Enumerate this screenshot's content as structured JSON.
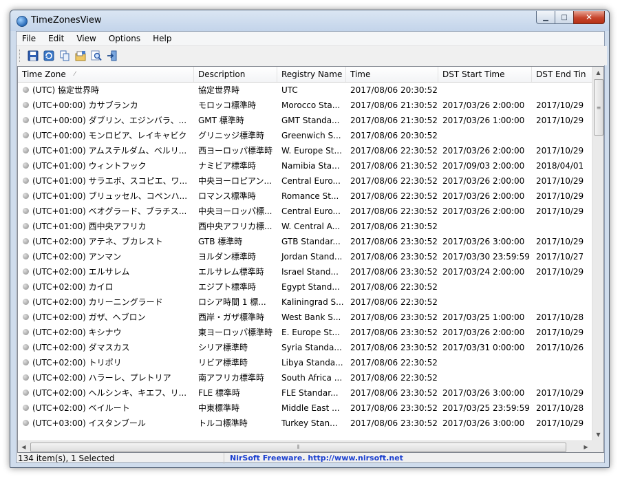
{
  "window": {
    "title": "TimeZonesView"
  },
  "menu": [
    "File",
    "Edit",
    "View",
    "Options",
    "Help"
  ],
  "toolbar": [
    {
      "name": "save-icon",
      "title": "Save Selected Items"
    },
    {
      "name": "refresh-icon",
      "title": "Refresh"
    },
    {
      "name": "copy-icon",
      "title": "Copy Selected Items"
    },
    {
      "name": "properties-icon",
      "title": "Properties"
    },
    {
      "name": "find-icon",
      "title": "Find"
    },
    {
      "name": "exit-icon",
      "title": "Exit"
    }
  ],
  "columns": [
    "Time Zone",
    "Description",
    "Registry Name",
    "Time",
    "DST Start Time",
    "DST End Tin"
  ],
  "sort_indicator": "⁄",
  "rows": [
    [
      "(UTC) 協定世界時",
      "協定世界時",
      "UTC",
      "2017/08/06 20:30:52",
      "",
      ""
    ],
    [
      "(UTC+00:00) カサブランカ",
      "モロッコ標準時",
      "Morocco Sta...",
      "2017/08/06 21:30:52",
      "2017/03/26 2:00:00",
      "2017/10/29"
    ],
    [
      "(UTC+00:00) ダブリン、エジンバラ、...",
      "GMT 標準時",
      "GMT Standa...",
      "2017/08/06 21:30:52",
      "2017/03/26 1:00:00",
      "2017/10/29"
    ],
    [
      "(UTC+00:00) モンロビア、レイキャビク",
      "グリニッジ標準時",
      "Greenwich S...",
      "2017/08/06 20:30:52",
      "",
      ""
    ],
    [
      "(UTC+01:00) アムステルダム、ベルリ...",
      "西ヨーロッパ標準時",
      "W. Europe St...",
      "2017/08/06 22:30:52",
      "2017/03/26 2:00:00",
      "2017/10/29"
    ],
    [
      "(UTC+01:00) ウィントフック",
      "ナミビア標準時",
      "Namibia Sta...",
      "2017/08/06 21:30:52",
      "2017/09/03 2:00:00",
      "2018/04/01"
    ],
    [
      "(UTC+01:00) サラエボ、スコピエ、ワ...",
      "中央ヨーロピアン...",
      "Central Euro...",
      "2017/08/06 22:30:52",
      "2017/03/26 2:00:00",
      "2017/10/29"
    ],
    [
      "(UTC+01:00) ブリュッセル、コペンハ...",
      "ロマンス標準時",
      "Romance St...",
      "2017/08/06 22:30:52",
      "2017/03/26 2:00:00",
      "2017/10/29"
    ],
    [
      "(UTC+01:00) ベオグラード、ブラチス...",
      "中央ヨーロッパ標...",
      "Central Euro...",
      "2017/08/06 22:30:52",
      "2017/03/26 2:00:00",
      "2017/10/29"
    ],
    [
      "(UTC+01:00) 西中央アフリカ",
      "西中央アフリカ標...",
      "W. Central A...",
      "2017/08/06 21:30:52",
      "",
      ""
    ],
    [
      "(UTC+02:00) アテネ、ブカレスト",
      "GTB 標準時",
      "GTB Standar...",
      "2017/08/06 23:30:52",
      "2017/03/26 3:00:00",
      "2017/10/29"
    ],
    [
      "(UTC+02:00) アンマン",
      "ヨルダン標準時",
      "Jordan Stand...",
      "2017/08/06 23:30:52",
      "2017/03/30 23:59:59",
      "2017/10/27"
    ],
    [
      "(UTC+02:00) エルサレム",
      "エルサレム標準時",
      "Israel Stand...",
      "2017/08/06 23:30:52",
      "2017/03/24 2:00:00",
      "2017/10/29"
    ],
    [
      "(UTC+02:00) カイロ",
      "エジプト標準時",
      "Egypt Stand...",
      "2017/08/06 22:30:52",
      "",
      ""
    ],
    [
      "(UTC+02:00) カリーニングラード",
      "ロシア時間 1 標...",
      "Kaliningrad S...",
      "2017/08/06 22:30:52",
      "",
      ""
    ],
    [
      "(UTC+02:00) ガザ、ヘブロン",
      "西岸・ガザ標準時",
      "West Bank S...",
      "2017/08/06 23:30:52",
      "2017/03/25 1:00:00",
      "2017/10/28"
    ],
    [
      "(UTC+02:00) キシナウ",
      "東ヨーロッパ標準時",
      "E. Europe St...",
      "2017/08/06 23:30:52",
      "2017/03/26 2:00:00",
      "2017/10/29"
    ],
    [
      "(UTC+02:00) ダマスカス",
      "シリア標準時",
      "Syria Standa...",
      "2017/08/06 23:30:52",
      "2017/03/31 0:00:00",
      "2017/10/26"
    ],
    [
      "(UTC+02:00) トリポリ",
      "リビア標準時",
      "Libya Standa...",
      "2017/08/06 22:30:52",
      "",
      ""
    ],
    [
      "(UTC+02:00) ハラーレ、プレトリア",
      "南アフリカ標準時",
      "South Africa ...",
      "2017/08/06 22:30:52",
      "",
      ""
    ],
    [
      "(UTC+02:00) ヘルシンキ、キエフ、リ...",
      "FLE 標準時",
      "FLE Standar...",
      "2017/08/06 23:30:52",
      "2017/03/26 3:00:00",
      "2017/10/29"
    ],
    [
      "(UTC+02:00) ベイルート",
      "中東標準時",
      "Middle East ...",
      "2017/08/06 23:30:52",
      "2017/03/25 23:59:59",
      "2017/10/28"
    ],
    [
      "(UTC+03:00) イスタンブール",
      "トルコ標準時",
      "Turkey Stan...",
      "2017/08/06 23:30:52",
      "2017/03/26 3:00:00",
      "2017/10/29"
    ]
  ],
  "status": {
    "count": "134 item(s), 1 Selected",
    "link": "NirSoft Freeware.  http://www.nirsoft.net"
  }
}
